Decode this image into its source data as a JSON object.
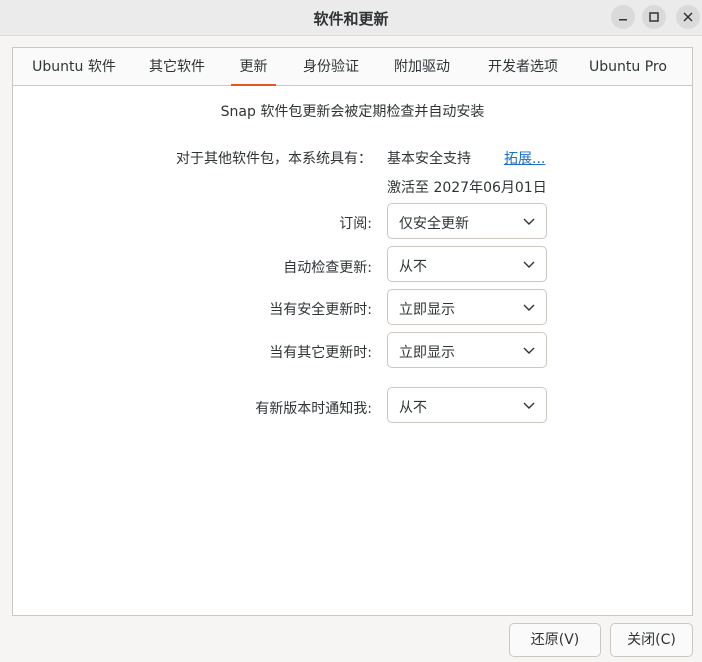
{
  "window": {
    "title": "软件和更新"
  },
  "tabs": [
    {
      "label": "Ubuntu 软件"
    },
    {
      "label": "其它软件"
    },
    {
      "label": "更新"
    },
    {
      "label": "身份验证"
    },
    {
      "label": "附加驱动"
    },
    {
      "label": "开发者选项"
    },
    {
      "label": "Ubuntu Pro"
    }
  ],
  "updates": {
    "snap_notice": "Snap 软件包更新会被定期检查并自动安装",
    "other_packages_label": "对于其他软件包，本系统具有：",
    "support_level": "基本安全支持",
    "extend_link": "拓展...",
    "activated_until": "激活至 2027年06月01日",
    "subscribed_label": "订阅:",
    "subscribed_value": "仅安全更新",
    "auto_check_label": "自动检查更新:",
    "auto_check_value": "从不",
    "security_updates_label": "当有安全更新时:",
    "security_updates_value": "立即显示",
    "other_updates_label": "当有其它更新时:",
    "other_updates_value": "立即显示",
    "notify_label": "有新版本时通知我:",
    "notify_value": "从不"
  },
  "buttons": {
    "revert": "还原(V)",
    "close": "关闭(C)"
  },
  "colors": {
    "accent": "#e95420",
    "link": "#1c6ec9"
  },
  "icons": {
    "minimize": "minimize-icon",
    "maximize": "maximize-icon",
    "close": "close-icon",
    "dropdown": "chevron-down-icon"
  }
}
